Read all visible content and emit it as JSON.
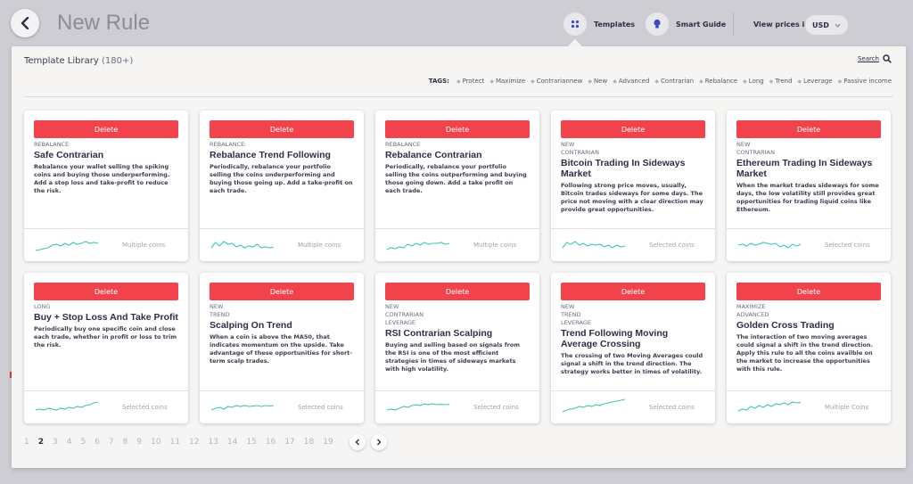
{
  "header": {
    "title": "New Rule",
    "templates_label": "Templates",
    "smart_guide_label": "Smart Guide",
    "view_prices_label": "View prices in:",
    "currency": "USD"
  },
  "library": {
    "title": "Template Library",
    "count": "(180+)",
    "search_label": "Search",
    "tags_label": "TAGS:",
    "tags": [
      "Protect",
      "Maximize",
      "Contrariannew",
      "New",
      "Advanced",
      "Contrarian",
      "Rebalance",
      "Long",
      "Trend",
      "Leverage",
      "Passive income"
    ]
  },
  "cards": [
    {
      "delete": "Delete",
      "tags": [
        "REBALANCE"
      ],
      "title": "Safe Contrarian",
      "desc": "Rebalance your wallet selling the spiking coins and buying those underperforming. Add a stop loss and take-profit to reduce the risk.",
      "coins": "Multiple coins"
    },
    {
      "delete": "Delete",
      "tags": [
        "REBALANCE"
      ],
      "title": "Rebalance Trend Following",
      "desc": "Periodically, rebalance your portfolio selling the coins underperforming and buying those going up. Add a take-profit on each trade.",
      "coins": "Multiple coins"
    },
    {
      "delete": "Delete",
      "tags": [
        "REBALANCE"
      ],
      "title": "Rebalance Contrarian",
      "desc": "Periodically, rebalance your portfolio selling the coins outperforming and buying those going down. Add a take profit on each trade.",
      "coins": "Multiple coins"
    },
    {
      "delete": "Delete",
      "tags": [
        "NEW",
        "CONTRARIAN"
      ],
      "title": "Bitcoin Trading In Sideways Market",
      "desc": "Following strong price moves, usually, Bitcoin trades sideways for some days. The price not moving with a clear direction may provide great opportunities.",
      "coins": "Selected coins"
    },
    {
      "delete": "Delete",
      "tags": [
        "NEW",
        "CONTRARIAN"
      ],
      "title": "Ethereum Trading In Sideways Market",
      "desc": "When the market trades sideways for some days, the low volatility still provides great opportunities for trading liquid coins like Ethereum.",
      "coins": "Selected coins"
    },
    {
      "delete": "Delete",
      "tags": [
        "LONG"
      ],
      "title": "Buy + Stop Loss And Take Profit",
      "desc": "Periodically buy one specific coin and close each trade, whether in profit or loss to trim the risk.",
      "coins": "Selected coins"
    },
    {
      "delete": "Delete",
      "tags": [
        "NEW",
        "TREND"
      ],
      "title": "Scalping On Trend",
      "desc": "When a coin is above the MA50, that indicates momentum on the upside. Take advantage of these opportunities for short-term scalp trades.",
      "coins": "Selected coins"
    },
    {
      "delete": "Delete",
      "tags": [
        "NEW",
        "CONTRARIAN",
        "LEVERAGE"
      ],
      "title": "RSI Contrarian Scalping",
      "desc": "Buying and selling based on signals from the RSI is one of the most efficient strategies in times of sideways markets with high volatility.",
      "coins": "Selected coins"
    },
    {
      "delete": "Delete",
      "tags": [
        "NEW",
        "TREND",
        "LEVERAGE"
      ],
      "title": "Trend Following Moving Average Crossing",
      "desc": "The crossing of two Moving Averages could signal a shift in the trend direction. The strategy works better in times of volatility.",
      "coins": "Selected coins"
    },
    {
      "delete": "Delete",
      "tags": [
        "MAXIMIZE",
        "ADVANCED"
      ],
      "title": "Golden Cross Trading",
      "desc": "The interaction of two moving averages could signal a shift in the trend direction. Apply this rule to all the coins availble on the market to increase the opportunities with this rule.",
      "coins": "Multiple Coins"
    }
  ],
  "sparklines": [
    [
      0.15,
      0.2,
      0.25,
      0.3,
      0.45,
      0.5,
      0.4,
      0.55,
      0.45,
      0.6,
      0.5,
      0.55,
      0.65,
      0.55,
      0.6,
      0.55
    ],
    [
      0.3,
      0.6,
      0.4,
      0.65,
      0.5,
      0.55,
      0.35,
      0.45,
      0.3,
      0.4,
      0.35,
      0.5,
      0.3,
      0.35,
      0.3,
      0.32
    ],
    [
      0.2,
      0.3,
      0.25,
      0.35,
      0.3,
      0.5,
      0.4,
      0.55,
      0.45,
      0.6,
      0.5,
      0.55,
      0.55,
      0.6,
      0.5,
      0.55
    ],
    [
      0.3,
      0.6,
      0.5,
      0.65,
      0.45,
      0.55,
      0.4,
      0.5,
      0.45,
      0.5,
      0.35,
      0.45,
      0.3,
      0.45,
      0.35,
      0.4
    ],
    [
      0.45,
      0.5,
      0.4,
      0.55,
      0.45,
      0.5,
      0.6,
      0.55,
      0.5,
      0.55,
      0.35,
      0.45,
      0.3,
      0.5,
      0.4,
      0.5
    ],
    [
      0.3,
      0.35,
      0.3,
      0.4,
      0.35,
      0.3,
      0.4,
      0.35,
      0.45,
      0.4,
      0.5,
      0.45,
      0.55,
      0.6,
      0.7,
      0.75
    ],
    [
      0.3,
      0.4,
      0.45,
      0.35,
      0.5,
      0.45,
      0.55,
      0.5,
      0.55,
      0.5,
      0.52,
      0.55,
      0.5,
      0.55,
      0.52,
      0.55
    ],
    [
      0.3,
      0.35,
      0.3,
      0.4,
      0.5,
      0.45,
      0.55,
      0.6,
      0.55,
      0.65,
      0.6,
      0.65,
      0.6,
      0.62,
      0.6,
      0.62
    ],
    [
      0.2,
      0.3,
      0.35,
      0.4,
      0.5,
      0.45,
      0.55,
      0.5,
      0.6,
      0.55,
      0.65,
      0.7,
      0.75,
      0.8,
      0.85,
      0.9
    ],
    [
      0.25,
      0.35,
      0.3,
      0.5,
      0.4,
      0.55,
      0.45,
      0.6,
      0.5,
      0.65,
      0.6,
      0.7,
      0.6,
      0.75,
      0.7,
      0.72
    ]
  ],
  "pagination": {
    "pages": [
      "1",
      "2",
      "3",
      "4",
      "5",
      "6",
      "7",
      "8",
      "9",
      "10",
      "11",
      "12",
      "13",
      "14",
      "15",
      "16",
      "17",
      "18",
      "19"
    ],
    "current": "2"
  },
  "colors": {
    "accent": "#f2424c",
    "spark": "#3ec6b3",
    "title": "#2b2f45",
    "icon_blue": "#3b49c9"
  }
}
